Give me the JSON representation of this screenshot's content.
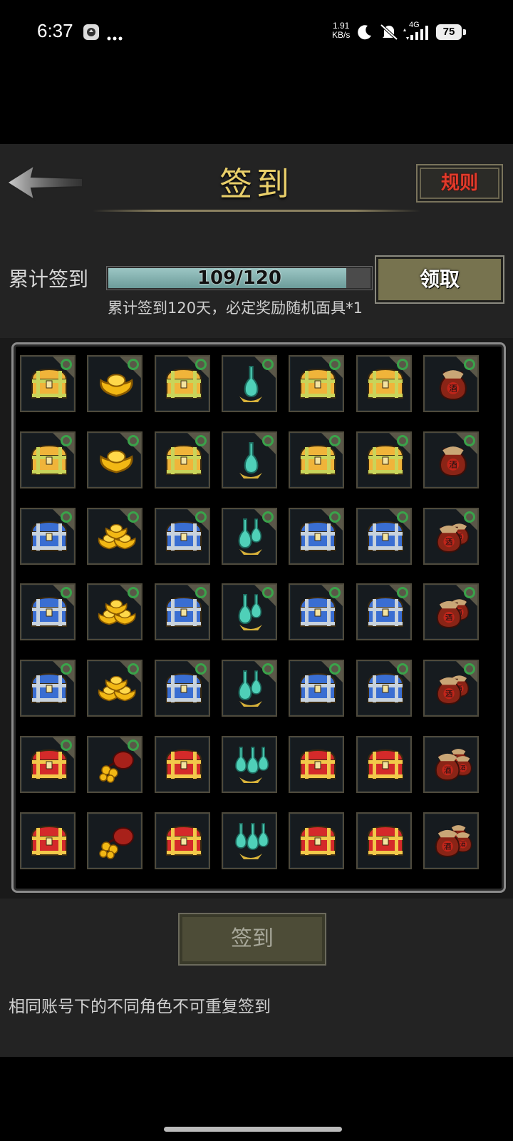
{
  "status_bar": {
    "time": "6:37",
    "speed_value": "1.91",
    "speed_unit": "KB/s",
    "network": "4G",
    "battery": "75"
  },
  "header": {
    "title": "签到",
    "rules_label": "规则"
  },
  "progress": {
    "label": "累计签到",
    "text": "109/120",
    "current": 109,
    "total": 120,
    "claim_label": "领取",
    "note": "累计签到120天，必定奖励随机面具*1"
  },
  "rewards": {
    "rows": [
      [
        "chest-gold",
        "ingot-single",
        "chest-gold",
        "bottle-single",
        "chest-gold",
        "chest-gold",
        "jar-single"
      ],
      [
        "chest-gold",
        "ingot-single",
        "chest-gold",
        "bottle-single",
        "chest-gold",
        "chest-gold",
        "jar-single"
      ],
      [
        "chest-blue",
        "ingot-pile",
        "chest-blue",
        "bottle-double",
        "chest-blue",
        "chest-blue",
        "jar-double"
      ],
      [
        "chest-blue",
        "ingot-pile",
        "chest-blue",
        "bottle-double",
        "chest-blue",
        "chest-blue",
        "jar-double"
      ],
      [
        "chest-blue",
        "ingot-pile",
        "chest-blue",
        "bottle-double",
        "chest-blue",
        "chest-blue",
        "jar-double"
      ],
      [
        "chest-red",
        "coin-bag",
        "chest-red",
        "bottle-triple",
        "chest-red",
        "chest-red",
        "jar-triple"
      ],
      [
        "chest-red",
        "coin-bag",
        "chest-red",
        "bottle-triple",
        "chest-red",
        "chest-red",
        "jar-triple"
      ]
    ],
    "claimed_days": 37,
    "jar_glyph": "酒"
  },
  "footer": {
    "signin_label": "签到",
    "note": "相同账号下的不同角色不可重复签到"
  },
  "colors": {
    "title_gold": "#e9cf6a",
    "rules_red": "#e23a2a",
    "check_green": "#3aa34a",
    "progress_fill": "#7fb0ae"
  }
}
